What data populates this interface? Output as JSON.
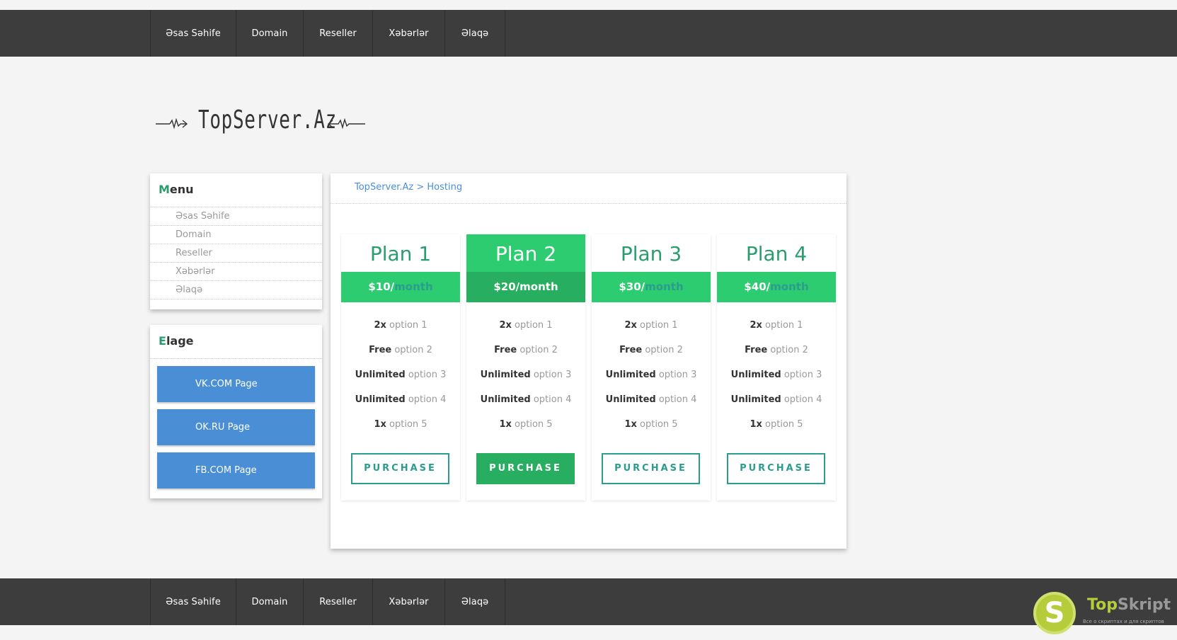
{
  "nav": {
    "items": [
      "Əsas Səhife",
      "Domain",
      "Reseller",
      "Xəbərlər",
      "Əlaqə"
    ]
  },
  "logo": {
    "text": "TopServer.Az"
  },
  "menu": {
    "title_first": "M",
    "title_rest": "enu",
    "items": [
      "Əsas Səhife",
      "Domain",
      "Reseller",
      "Xəbərlər",
      "Əlaqə"
    ]
  },
  "elage": {
    "title_first": "E",
    "title_rest": "lage",
    "buttons": [
      "VK.COM Page",
      "OK.RU Page",
      "FB.COM Page"
    ]
  },
  "breadcrumb": {
    "root": "TopServer.Az",
    "separator": " > ",
    "current": "Hosting"
  },
  "plans": [
    {
      "name": "Plan 1",
      "price": "$10/",
      "per": "month",
      "featured": false
    },
    {
      "name": "Plan 2",
      "price": "$20/",
      "per": "month",
      "featured": true
    },
    {
      "name": "Plan 3",
      "price": "$30/",
      "per": "month",
      "featured": false
    },
    {
      "name": "Plan 4",
      "price": "$40/",
      "per": "month",
      "featured": false
    }
  ],
  "features": [
    {
      "bold": "2x",
      "text": " option 1"
    },
    {
      "bold": "Free",
      "text": " option 2"
    },
    {
      "bold": "Unlimited",
      "text": " option 3"
    },
    {
      "bold": "Unlimited",
      "text": " option 4"
    },
    {
      "bold": "1x",
      "text": " option 5"
    }
  ],
  "purchase_label": "PURCHASE",
  "watermark": {
    "letter": "S",
    "brand_a": "Top",
    "brand_b": "Skript",
    "sub": "Все о скриптах и для скриптов"
  },
  "colors": {
    "nav_bg": "#3d3d3d",
    "green": "#2ecc71",
    "dark_green": "#27ae60",
    "teal": "#2a9d8f",
    "blue": "#4a8fd6"
  }
}
